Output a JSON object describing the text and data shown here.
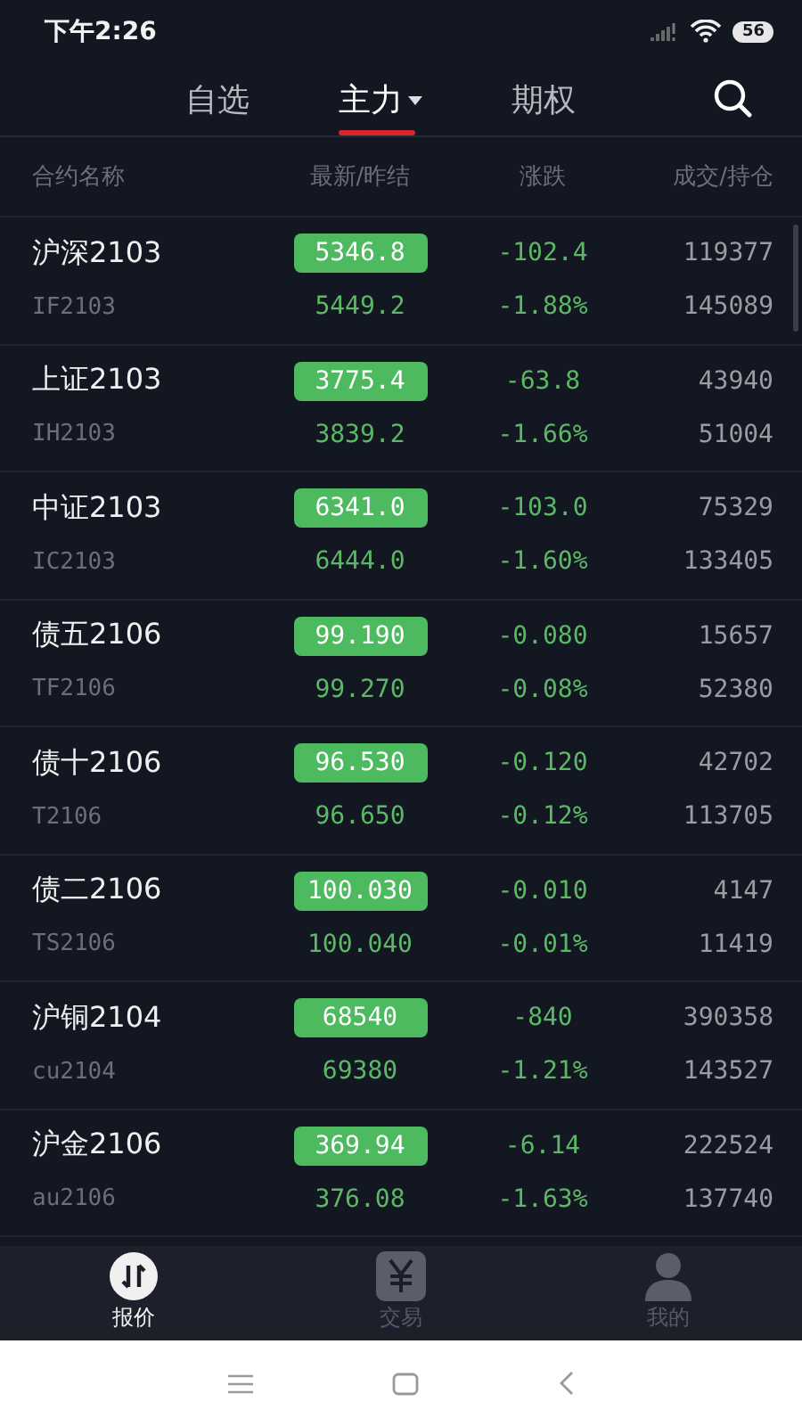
{
  "status_bar": {
    "time": "下午2:26",
    "battery": "56"
  },
  "tabs": [
    {
      "label": "自选",
      "selected": false,
      "dropdown": false
    },
    {
      "label": "主力",
      "selected": true,
      "dropdown": true
    },
    {
      "label": "期权",
      "selected": false,
      "dropdown": false
    }
  ],
  "columns": [
    "合约名称",
    "最新/昨结",
    "涨跌",
    "成交/持仓"
  ],
  "rows": [
    {
      "name": "沪深2103",
      "code": "IF2103",
      "latest": "5346.8",
      "prev_settle": "5449.2",
      "change": "-102.4",
      "change_pct": "-1.88%",
      "volume": "119377",
      "open_interest": "145089"
    },
    {
      "name": "上证2103",
      "code": "IH2103",
      "latest": "3775.4",
      "prev_settle": "3839.2",
      "change": "-63.8",
      "change_pct": "-1.66%",
      "volume": "43940",
      "open_interest": "51004"
    },
    {
      "name": "中证2103",
      "code": "IC2103",
      "latest": "6341.0",
      "prev_settle": "6444.0",
      "change": "-103.0",
      "change_pct": "-1.60%",
      "volume": "75329",
      "open_interest": "133405"
    },
    {
      "name": "债五2106",
      "code": "TF2106",
      "latest": "99.190",
      "prev_settle": "99.270",
      "change": "-0.080",
      "change_pct": "-0.08%",
      "volume": "15657",
      "open_interest": "52380"
    },
    {
      "name": "债十2106",
      "code": "T2106",
      "latest": "96.530",
      "prev_settle": "96.650",
      "change": "-0.120",
      "change_pct": "-0.12%",
      "volume": "42702",
      "open_interest": "113705"
    },
    {
      "name": "债二2106",
      "code": "TS2106",
      "latest": "100.030",
      "prev_settle": "100.040",
      "change": "-0.010",
      "change_pct": "-0.01%",
      "volume": "4147",
      "open_interest": "11419"
    },
    {
      "name": "沪铜2104",
      "code": "cu2104",
      "latest": "68540",
      "prev_settle": "69380",
      "change": "-840",
      "change_pct": "-1.21%",
      "volume": "390358",
      "open_interest": "143527"
    },
    {
      "name": "沪金2106",
      "code": "au2106",
      "latest": "369.94",
      "prev_settle": "376.08",
      "change": "-6.14",
      "change_pct": "-1.63%",
      "volume": "222524",
      "open_interest": "137740"
    }
  ],
  "bottom_nav": [
    {
      "kind": "quote",
      "label": "报价",
      "selected": true
    },
    {
      "kind": "trade",
      "label": "交易",
      "selected": false
    },
    {
      "kind": "profile",
      "label": "我的",
      "selected": false
    }
  ]
}
